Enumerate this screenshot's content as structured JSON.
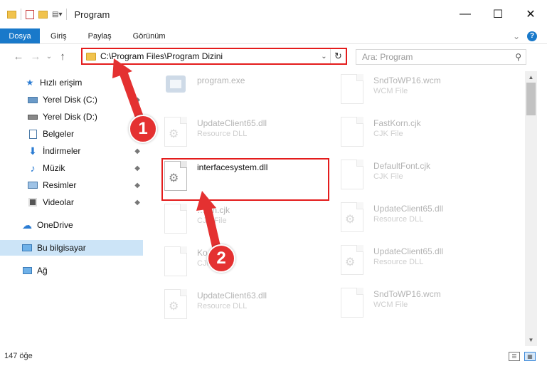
{
  "window": {
    "title": "Program",
    "controls": {
      "minimize": "—",
      "maximize": "☐",
      "close": "✕"
    }
  },
  "ribbon": {
    "file_tab": "Dosya",
    "tabs": [
      "Giriş",
      "Paylaş",
      "Görünüm"
    ],
    "chevron": "⌄",
    "help": "?"
  },
  "nav": {
    "back": "←",
    "forward": "→",
    "dropdown": "⌄",
    "up": "↑",
    "address": "C:\\Program Files\\Program Dizini",
    "address_dropdown": "⌄",
    "refresh": "↻",
    "search_placeholder": "Ara: Program",
    "search_icon": "⚲"
  },
  "sidebar": {
    "quick_access": "Hızlı erişim",
    "items": [
      {
        "label": "Yerel Disk (C:)",
        "icon": "drive-icon",
        "pinned": true
      },
      {
        "label": "Yerel Disk (D:)",
        "icon": "drive-icon",
        "pinned": false
      },
      {
        "label": "Belgeler",
        "icon": "documents-icon",
        "pinned": true
      },
      {
        "label": "İndirmeler",
        "icon": "download-icon",
        "pinned": true
      },
      {
        "label": "Müzik",
        "icon": "music-icon",
        "pinned": true
      },
      {
        "label": "Resimler",
        "icon": "pictures-icon",
        "pinned": true
      },
      {
        "label": "Videolar",
        "icon": "videos-icon",
        "pinned": true
      }
    ],
    "onedrive": "OneDrive",
    "this_pc": "Bu bilgisayar",
    "network": "Ağ",
    "pin_glyph": "📌"
  },
  "files": {
    "left": [
      {
        "name": "program.exe",
        "type": "",
        "kind": "exe",
        "highlight": false
      },
      {
        "name": "UpdateClient65.dll",
        "type": "Resource DLL",
        "kind": "dll",
        "highlight": false
      },
      {
        "name": "interfacesystem.dll",
        "type": "",
        "kind": "dll",
        "highlight": true
      },
      {
        "name": "…ion.cjk",
        "type": "CJK File",
        "kind": "doc",
        "highlight": false
      },
      {
        "name": "Ko…k",
        "type": "CJK File",
        "kind": "doc",
        "highlight": false
      },
      {
        "name": "UpdateClient63.dll",
        "type": "Resource DLL",
        "kind": "dll",
        "highlight": false
      }
    ],
    "right": [
      {
        "name": "SndToWP16.wcm",
        "type": "WCM File",
        "kind": "doc"
      },
      {
        "name": "FastKorn.cjk",
        "type": "CJK File",
        "kind": "doc"
      },
      {
        "name": "DefaultFont.cjk",
        "type": "CJK File",
        "kind": "doc"
      },
      {
        "name": "UpdateClient65.dll",
        "type": "Resource DLL",
        "kind": "dll"
      },
      {
        "name": "UpdateClient65.dll",
        "type": "Resource DLL",
        "kind": "dll"
      },
      {
        "name": "SndToWP16.wcm",
        "type": "WCM File",
        "kind": "doc"
      }
    ]
  },
  "scrollbar": {
    "up": "▲",
    "down": "▼"
  },
  "status": {
    "count": "147 öğe",
    "details_view": "☰",
    "icons_view": "▦"
  },
  "callouts": {
    "one": "1",
    "two": "2"
  },
  "colors": {
    "accent": "#1979ca",
    "highlight": "#e41c1c",
    "callout": "#e43131",
    "selected": "#cce4f7"
  }
}
